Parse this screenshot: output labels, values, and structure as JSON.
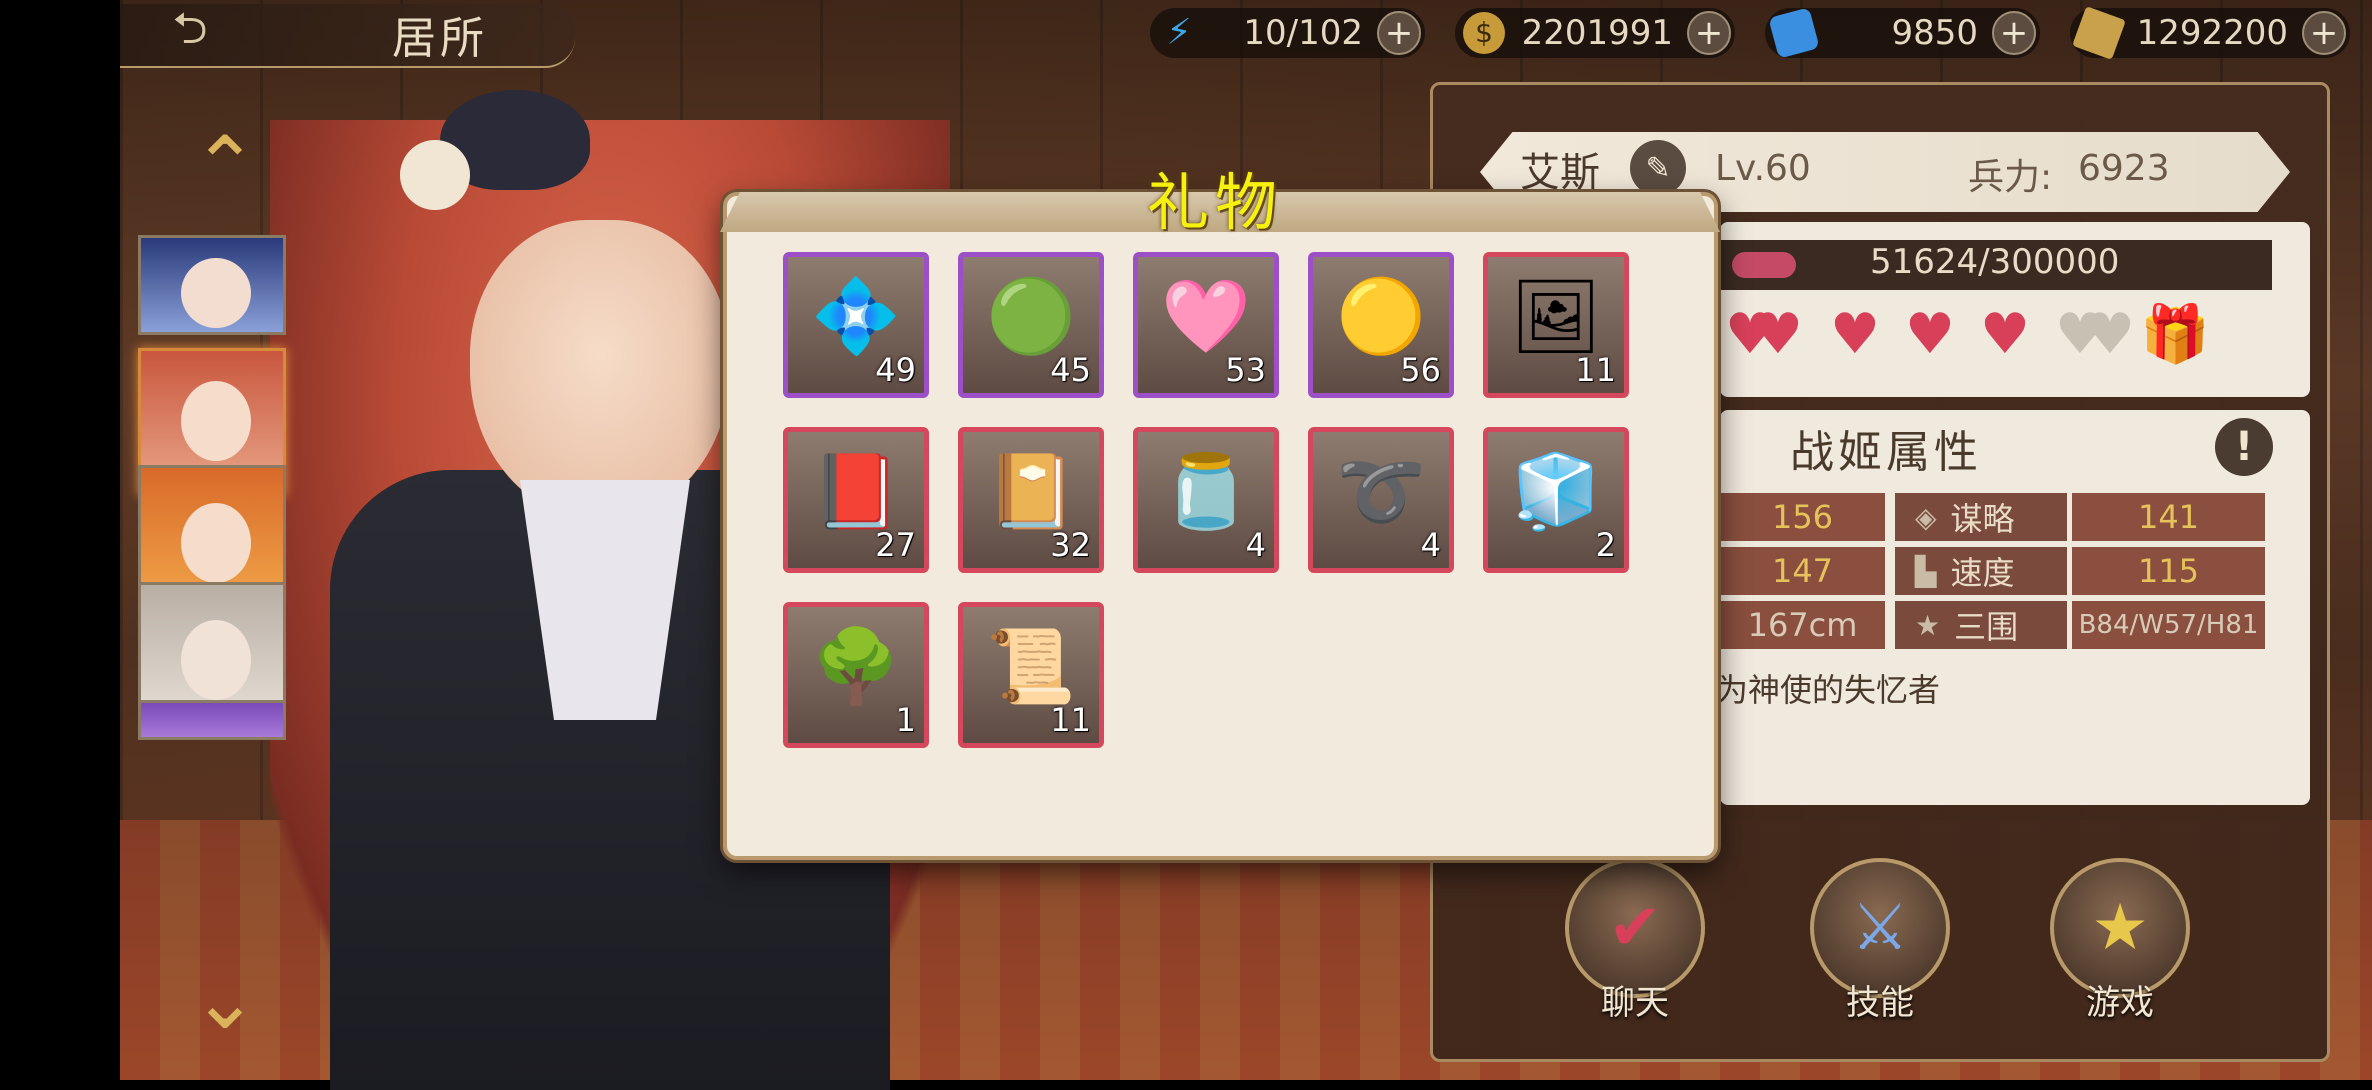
{
  "topbar": {
    "back_icon": "back-arrow-icon",
    "location_title": "居所",
    "resources": [
      {
        "name": "energy",
        "icon": "lightning-icon",
        "value": "10/102",
        "color": "#3aa8e8"
      },
      {
        "name": "gold",
        "icon": "coin-icon",
        "value": "2201991",
        "color": "#c79a3a"
      },
      {
        "name": "crystal",
        "icon": "ticket-icon",
        "value": "9850",
        "color": "#3a8fe0"
      },
      {
        "name": "gem",
        "icon": "gem-icon",
        "value": "1292200",
        "color": "#c9a14a"
      }
    ],
    "plus_label": "+"
  },
  "character": {
    "name": "艾斯",
    "level": "Lv.60",
    "troops_label": "兵力:",
    "troops_value": "6923",
    "exp": "51624/300000",
    "exp_progress": 0.17,
    "hearts_full": 5,
    "hearts_empty": 2
  },
  "attributes": {
    "title": "战姬属性",
    "rows": [
      {
        "left_value": "156",
        "label": "谋略",
        "right_value": "141"
      },
      {
        "left_value": "147",
        "label": "速度",
        "right_value": "115"
      },
      {
        "left_value": "167cm",
        "label": "三围",
        "right_value": "B84/W57/H81"
      }
    ],
    "bio": "为神使的失忆者"
  },
  "actions": [
    {
      "label": "聊天",
      "icon": "heart-check-icon"
    },
    {
      "label": "技能",
      "icon": "sword-shield-icon"
    },
    {
      "label": "游戏",
      "icon": "star-wand-icon"
    }
  ],
  "gift_modal": {
    "title": "礼物",
    "items": [
      {
        "icon": "blue-bead-pile-icon",
        "qty": "49",
        "rarity": "purple",
        "art": "💠"
      },
      {
        "icon": "green-bead-pile-icon",
        "qty": "45",
        "rarity": "purple",
        "art": "🟢"
      },
      {
        "icon": "pink-bead-pile-icon",
        "qty": "53",
        "rarity": "purple",
        "art": "🩷"
      },
      {
        "icon": "yellow-bead-pile-icon",
        "qty": "56",
        "rarity": "purple",
        "art": "🟡"
      },
      {
        "icon": "photo-frame-icon",
        "qty": "11",
        "rarity": "red",
        "art": "🖼"
      },
      {
        "icon": "photo-album-icon",
        "qty": "27",
        "rarity": "red",
        "art": "📕"
      },
      {
        "icon": "love-diary-icon",
        "qty": "32",
        "rarity": "red",
        "art": "📔"
      },
      {
        "icon": "hip-flask-icon",
        "qty": "4",
        "rarity": "red",
        "art": "🫙"
      },
      {
        "icon": "belt-icon",
        "qty": "4",
        "rarity": "red",
        "art": "➰"
      },
      {
        "icon": "lighter-icon",
        "qty": "2",
        "rarity": "red",
        "art": "🧊"
      },
      {
        "icon": "bonsai-icon",
        "qty": "1",
        "rarity": "red",
        "art": "🌳"
      },
      {
        "icon": "scroll-icon",
        "qty": "11",
        "rarity": "red",
        "art": "📜"
      }
    ]
  }
}
